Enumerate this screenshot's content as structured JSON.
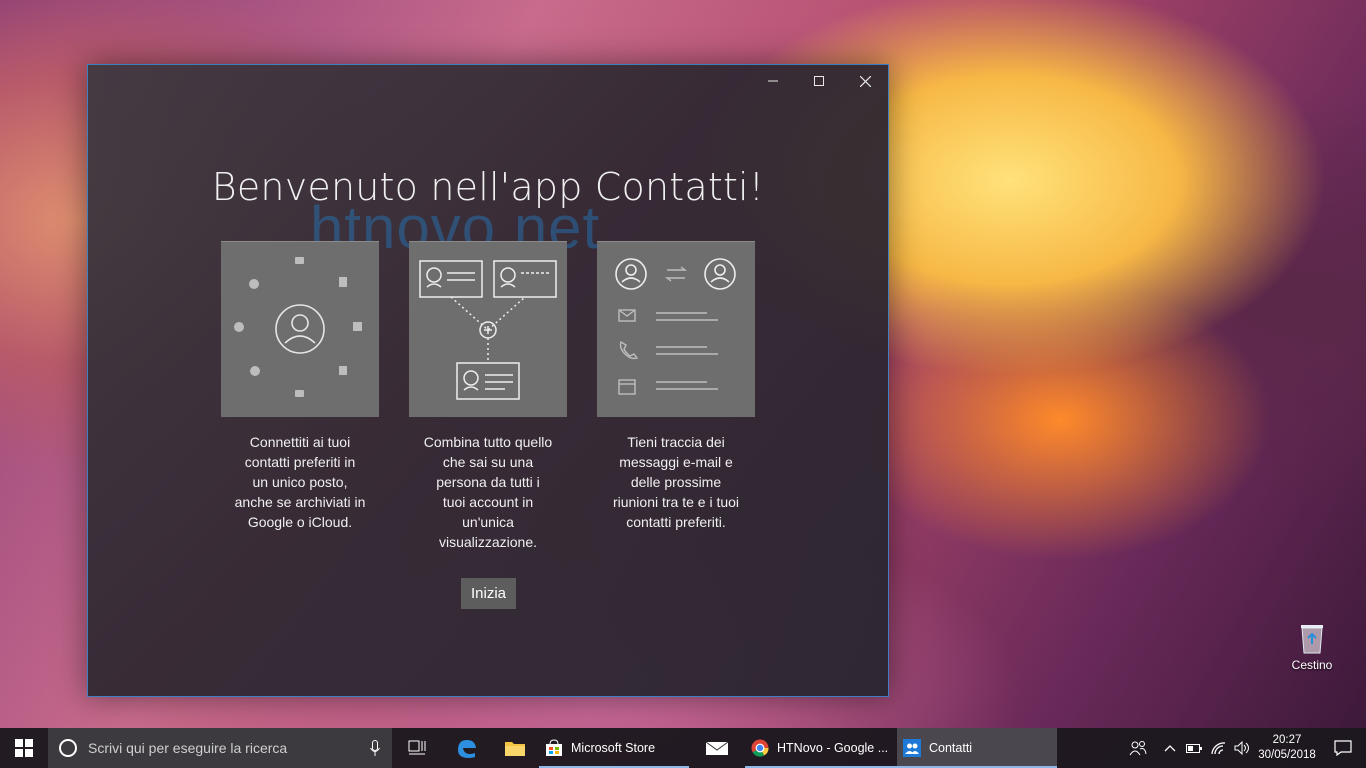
{
  "window": {
    "title": "Benvenuto nell'app Contatti!",
    "watermark": "htnovo.net",
    "controls": [
      "minimize",
      "maximize",
      "close"
    ]
  },
  "features": [
    {
      "icon": "contacts-sources-icon",
      "text": "Connettiti ai tuoi\ncontatti preferiti in\nun unico posto,\nanche se archiviati in\nGoogle o iCloud."
    },
    {
      "icon": "merge-contacts-icon",
      "text": "Combina tutto quello\nche sai su una\npersona da tutti i\ntuoi account in\nun'unica\nvisualizzazione."
    },
    {
      "icon": "contact-details-icon",
      "text": "Tieni traccia dei\nmessaggi e-mail e\ndelle prossime\nriunioni tra te e i tuoi\ncontatti preferiti."
    }
  ],
  "start_button": "Inizia",
  "desktop": {
    "recycle_bin_label": "Cestino"
  },
  "taskbar": {
    "search_placeholder": "Scrivi qui per eseguire la ricerca",
    "apps": [
      {
        "label": "Microsoft Store",
        "icon": "store-icon"
      },
      {
        "label": "",
        "icon": "mail-icon"
      },
      {
        "label": "HTNovo - Google ...",
        "icon": "chrome-icon"
      },
      {
        "label": "Contatti",
        "icon": "people-icon",
        "active": true
      }
    ],
    "time": "20:27",
    "date": "30/05/2018"
  }
}
